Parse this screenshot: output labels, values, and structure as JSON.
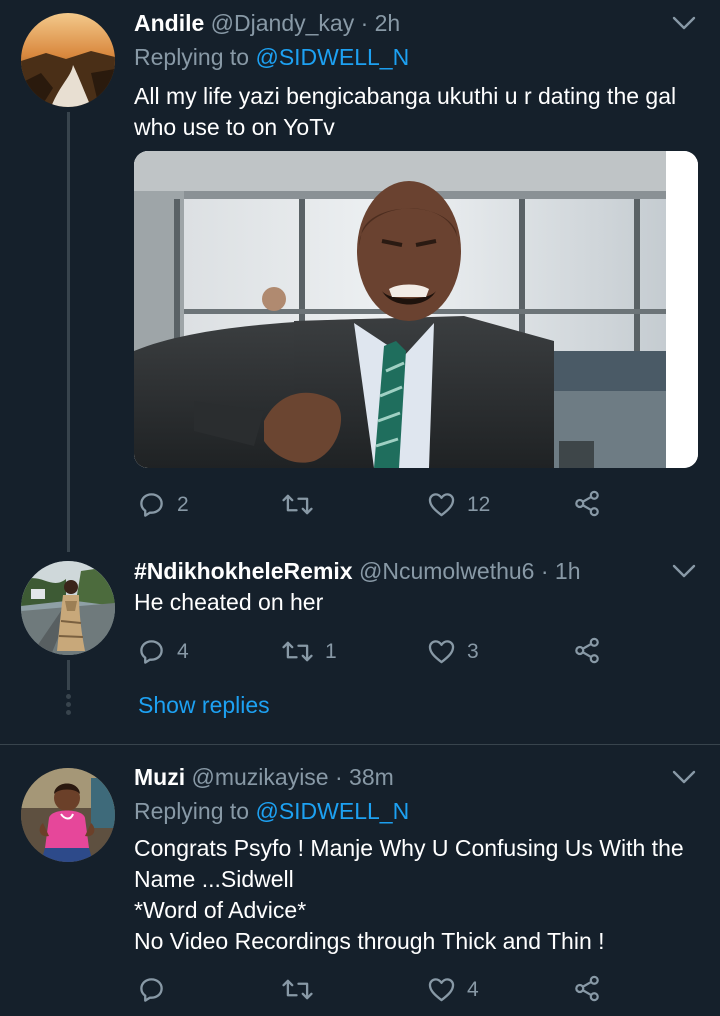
{
  "tweets": [
    {
      "name": "Andile",
      "handle": "@Djandy_kay",
      "time": "· 2h",
      "replying_prefix": "Replying to ",
      "replying_to": "@SIDWELL_N",
      "text_lines": [
        "All my life yazi bengicabanga ukuthi u r dating the gal",
        "who use to on YoTv"
      ],
      "counts": {
        "replies": "2",
        "retweets": "",
        "likes": "12"
      }
    },
    {
      "name": "#NdikhokheleRemix",
      "handle": "@Ncumolwethu6",
      "time": "· 1h",
      "text_lines": [
        "He cheated on her"
      ],
      "counts": {
        "replies": "4",
        "retweets": "1",
        "likes": "3"
      }
    },
    {
      "name": "Muzi",
      "handle": "@muzikayise",
      "time": "· 38m",
      "replying_prefix": "Replying to ",
      "replying_to": "@SIDWELL_N",
      "text_lines": [
        "Congrats Psyfo ! Manje Why U Confusing Us With the",
        "Name ...Sidwell",
        "*Word of Advice*",
        "No Video Recordings through Thick and Thin !"
      ],
      "counts": {
        "replies": "",
        "retweets": "",
        "likes": "4"
      }
    }
  ],
  "show_replies": "Show replies",
  "colors": {
    "background": "#15202b",
    "secondary_text": "#8899a6",
    "link": "#1da1f2",
    "divider": "#38444d"
  },
  "icons": [
    "chevron-down-icon",
    "reply-icon",
    "retweet-icon",
    "like-icon",
    "share-icon"
  ]
}
